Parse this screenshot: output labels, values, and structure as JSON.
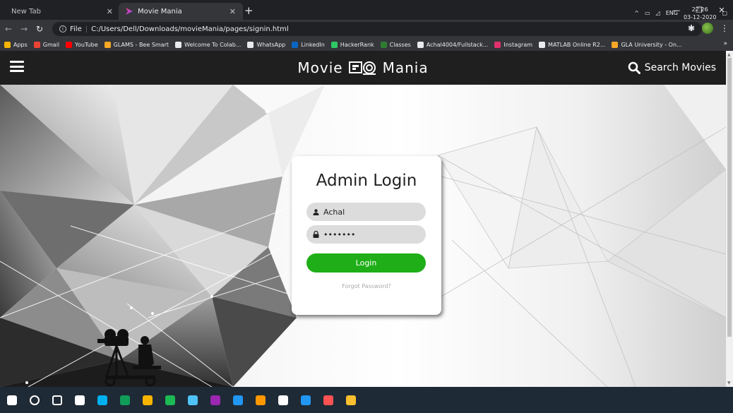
{
  "browser": {
    "tabs": [
      {
        "title": "New Tab",
        "active": false
      },
      {
        "title": "Movie Mania",
        "active": true
      }
    ],
    "url_label": "File",
    "url": "C:/Users/Dell/Downloads/movieMania/pages/signin.html",
    "bookmarks": [
      {
        "label": "Apps",
        "color": "#f4b400"
      },
      {
        "label": "Gmail",
        "color": "#ea4335"
      },
      {
        "label": "YouTube",
        "color": "#ff0000"
      },
      {
        "label": "GLAMS - Bee Smart",
        "color": "#f9a825"
      },
      {
        "label": "Welcome To Colab...",
        "color": "#e8eaed"
      },
      {
        "label": "WhatsApp",
        "color": "#e8eaed"
      },
      {
        "label": "LinkedIn",
        "color": "#0a66c2"
      },
      {
        "label": "HackerRank",
        "color": "#2ec866"
      },
      {
        "label": "Classes",
        "color": "#2e7d32"
      },
      {
        "label": "Achal4004/Fullstack...",
        "color": "#e8eaed"
      },
      {
        "label": "Instagram",
        "color": "#e1306c"
      },
      {
        "label": "MATLAB Online R2...",
        "color": "#e8eaed"
      },
      {
        "label": "GLA University - On...",
        "color": "#f9a825"
      }
    ],
    "bookmarks_more": "»"
  },
  "header": {
    "brand_left": "Movie",
    "brand_right": "Mania",
    "search_label": "Search Movies"
  },
  "login": {
    "title": "Admin Login",
    "username_value": "Achal",
    "password_value": "•••••••",
    "button_label": "Login",
    "forgot_label": "Forgot Password?"
  },
  "taskbar": {
    "language": "ENG",
    "time": "22:26",
    "date": "03-12-2020",
    "apps": [
      {
        "name": "start-icon",
        "color": "#ffffff"
      },
      {
        "name": "search-circle-icon",
        "color": "#ffffff"
      },
      {
        "name": "task-view-icon",
        "color": "#ffffff"
      },
      {
        "name": "mail-icon",
        "color": "#ffffff"
      },
      {
        "name": "skype-icon",
        "color": "#00aff0"
      },
      {
        "name": "edge-icon",
        "color": "#0f9d58"
      },
      {
        "name": "chrome-icon",
        "color": "#f4b400"
      },
      {
        "name": "spotify-icon",
        "color": "#1db954"
      },
      {
        "name": "app-icon",
        "color": "#4fc3f7"
      },
      {
        "name": "github-desktop-icon",
        "color": "#9c27b0"
      },
      {
        "name": "app-blue-icon",
        "color": "#2196f3"
      },
      {
        "name": "app-orange-icon",
        "color": "#ff9800"
      },
      {
        "name": "app-window-icon",
        "color": "#ffffff"
      },
      {
        "name": "vscode-icon",
        "color": "#2196f3"
      },
      {
        "name": "settings-icon",
        "color": "#ff5252"
      },
      {
        "name": "file-explorer-icon",
        "color": "#fbc02d"
      }
    ]
  }
}
